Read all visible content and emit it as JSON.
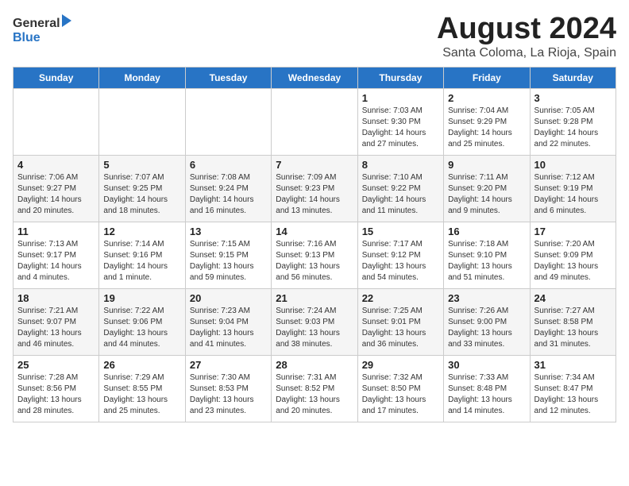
{
  "logo": {
    "general": "General",
    "blue": "Blue"
  },
  "title": "August 2024",
  "subtitle": "Santa Coloma, La Rioja, Spain",
  "days_of_week": [
    "Sunday",
    "Monday",
    "Tuesday",
    "Wednesday",
    "Thursday",
    "Friday",
    "Saturday"
  ],
  "weeks": [
    [
      {
        "day": "",
        "info": ""
      },
      {
        "day": "",
        "info": ""
      },
      {
        "day": "",
        "info": ""
      },
      {
        "day": "",
        "info": ""
      },
      {
        "day": "1",
        "info": "Sunrise: 7:03 AM\nSunset: 9:30 PM\nDaylight: 14 hours\nand 27 minutes."
      },
      {
        "day": "2",
        "info": "Sunrise: 7:04 AM\nSunset: 9:29 PM\nDaylight: 14 hours\nand 25 minutes."
      },
      {
        "day": "3",
        "info": "Sunrise: 7:05 AM\nSunset: 9:28 PM\nDaylight: 14 hours\nand 22 minutes."
      }
    ],
    [
      {
        "day": "4",
        "info": "Sunrise: 7:06 AM\nSunset: 9:27 PM\nDaylight: 14 hours\nand 20 minutes."
      },
      {
        "day": "5",
        "info": "Sunrise: 7:07 AM\nSunset: 9:25 PM\nDaylight: 14 hours\nand 18 minutes."
      },
      {
        "day": "6",
        "info": "Sunrise: 7:08 AM\nSunset: 9:24 PM\nDaylight: 14 hours\nand 16 minutes."
      },
      {
        "day": "7",
        "info": "Sunrise: 7:09 AM\nSunset: 9:23 PM\nDaylight: 14 hours\nand 13 minutes."
      },
      {
        "day": "8",
        "info": "Sunrise: 7:10 AM\nSunset: 9:22 PM\nDaylight: 14 hours\nand 11 minutes."
      },
      {
        "day": "9",
        "info": "Sunrise: 7:11 AM\nSunset: 9:20 PM\nDaylight: 14 hours\nand 9 minutes."
      },
      {
        "day": "10",
        "info": "Sunrise: 7:12 AM\nSunset: 9:19 PM\nDaylight: 14 hours\nand 6 minutes."
      }
    ],
    [
      {
        "day": "11",
        "info": "Sunrise: 7:13 AM\nSunset: 9:17 PM\nDaylight: 14 hours\nand 4 minutes."
      },
      {
        "day": "12",
        "info": "Sunrise: 7:14 AM\nSunset: 9:16 PM\nDaylight: 14 hours\nand 1 minute."
      },
      {
        "day": "13",
        "info": "Sunrise: 7:15 AM\nSunset: 9:15 PM\nDaylight: 13 hours\nand 59 minutes."
      },
      {
        "day": "14",
        "info": "Sunrise: 7:16 AM\nSunset: 9:13 PM\nDaylight: 13 hours\nand 56 minutes."
      },
      {
        "day": "15",
        "info": "Sunrise: 7:17 AM\nSunset: 9:12 PM\nDaylight: 13 hours\nand 54 minutes."
      },
      {
        "day": "16",
        "info": "Sunrise: 7:18 AM\nSunset: 9:10 PM\nDaylight: 13 hours\nand 51 minutes."
      },
      {
        "day": "17",
        "info": "Sunrise: 7:20 AM\nSunset: 9:09 PM\nDaylight: 13 hours\nand 49 minutes."
      }
    ],
    [
      {
        "day": "18",
        "info": "Sunrise: 7:21 AM\nSunset: 9:07 PM\nDaylight: 13 hours\nand 46 minutes."
      },
      {
        "day": "19",
        "info": "Sunrise: 7:22 AM\nSunset: 9:06 PM\nDaylight: 13 hours\nand 44 minutes."
      },
      {
        "day": "20",
        "info": "Sunrise: 7:23 AM\nSunset: 9:04 PM\nDaylight: 13 hours\nand 41 minutes."
      },
      {
        "day": "21",
        "info": "Sunrise: 7:24 AM\nSunset: 9:03 PM\nDaylight: 13 hours\nand 38 minutes."
      },
      {
        "day": "22",
        "info": "Sunrise: 7:25 AM\nSunset: 9:01 PM\nDaylight: 13 hours\nand 36 minutes."
      },
      {
        "day": "23",
        "info": "Sunrise: 7:26 AM\nSunset: 9:00 PM\nDaylight: 13 hours\nand 33 minutes."
      },
      {
        "day": "24",
        "info": "Sunrise: 7:27 AM\nSunset: 8:58 PM\nDaylight: 13 hours\nand 31 minutes."
      }
    ],
    [
      {
        "day": "25",
        "info": "Sunrise: 7:28 AM\nSunset: 8:56 PM\nDaylight: 13 hours\nand 28 minutes."
      },
      {
        "day": "26",
        "info": "Sunrise: 7:29 AM\nSunset: 8:55 PM\nDaylight: 13 hours\nand 25 minutes."
      },
      {
        "day": "27",
        "info": "Sunrise: 7:30 AM\nSunset: 8:53 PM\nDaylight: 13 hours\nand 23 minutes."
      },
      {
        "day": "28",
        "info": "Sunrise: 7:31 AM\nSunset: 8:52 PM\nDaylight: 13 hours\nand 20 minutes."
      },
      {
        "day": "29",
        "info": "Sunrise: 7:32 AM\nSunset: 8:50 PM\nDaylight: 13 hours\nand 17 minutes."
      },
      {
        "day": "30",
        "info": "Sunrise: 7:33 AM\nSunset: 8:48 PM\nDaylight: 13 hours\nand 14 minutes."
      },
      {
        "day": "31",
        "info": "Sunrise: 7:34 AM\nSunset: 8:47 PM\nDaylight: 13 hours\nand 12 minutes."
      }
    ]
  ]
}
